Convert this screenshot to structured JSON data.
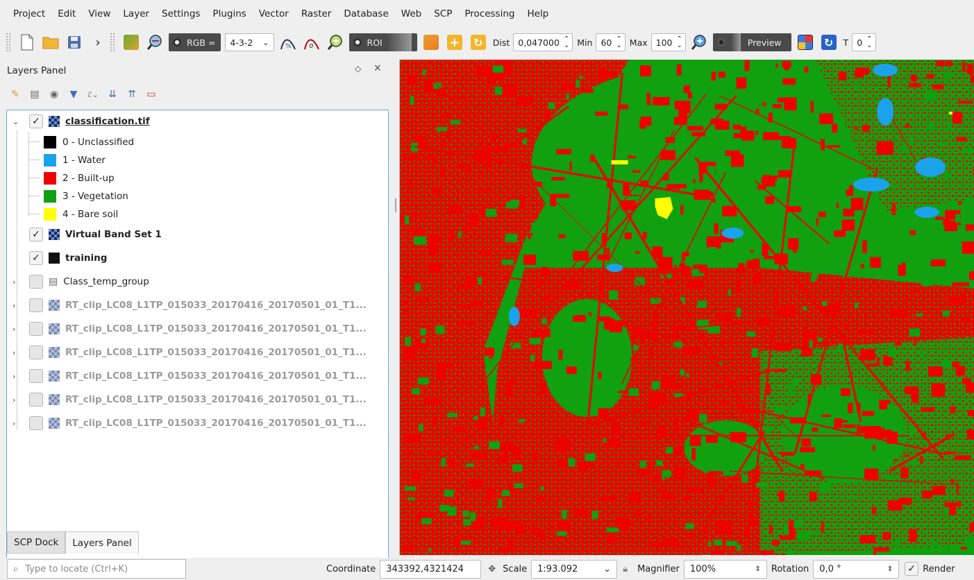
{
  "menu": [
    "Project",
    "Edit",
    "View",
    "Layer",
    "Settings",
    "Plugins",
    "Vector",
    "Raster",
    "Database",
    "Web",
    "SCP",
    "Processing",
    "Help"
  ],
  "toolbar": {
    "rgb_label": "RGB =",
    "rgb_value": "4-3-2",
    "roi_label": "ROI",
    "dist_label": "Dist",
    "dist_value": "0,047000",
    "min_label": "Min",
    "min_value": "60",
    "max_label": "Max",
    "max_value": "100",
    "preview_label": "Preview",
    "t_label": "T",
    "t_value": "0",
    "overflow": "›"
  },
  "dock": {
    "title": "Layers Panel",
    "float_btn": "◇",
    "close_btn": "×",
    "tabs": [
      "SCP Dock",
      "Layers Panel"
    ]
  },
  "layers": {
    "classification": {
      "name": "classification.tif",
      "classes": [
        {
          "label": "0 - Unclassified",
          "color": "#000000"
        },
        {
          "label": "1 - Water",
          "color": "#1aa3ea"
        },
        {
          "label": "2 - Built-up",
          "color": "#ee0000"
        },
        {
          "label": "3 - Vegetation",
          "color": "#10a010"
        },
        {
          "label": "4 - Bare soil",
          "color": "#ffff00"
        }
      ]
    },
    "band_set": "Virtual Band Set 1",
    "training": "training",
    "temp_group": "Class_temp_group",
    "rt_clips": [
      "RT_clip_LC08_L1TP_015033_20170416_20170501_01_T1...",
      "RT_clip_LC08_L1TP_015033_20170416_20170501_01_T1...",
      "RT_clip_LC08_L1TP_015033_20170416_20170501_01_T1...",
      "RT_clip_LC08_L1TP_015033_20170416_20170501_01_T1...",
      "RT_clip_LC08_L1TP_015033_20170416_20170501_01_T1...",
      "RT_clip_LC08_L1TP_015033_20170416_20170501_01_T1..."
    ]
  },
  "statusbar": {
    "locate_placeholder": "Type to locate (Ctrl+K)",
    "coordinate_label": "Coordinate",
    "coordinate_value": "343392,4321424",
    "scale_label": "Scale",
    "scale_value": "1:93.092",
    "magnifier_label": "Magnifier",
    "magnifier_value": "100%",
    "rotation_label": "Rotation",
    "rotation_value": "0,0 °",
    "render_label": "Render"
  },
  "colors": {
    "built_up": "#ee0000",
    "vegetation": "#10a010",
    "water": "#1aa3ea",
    "bare_soil": "#ffff00"
  }
}
